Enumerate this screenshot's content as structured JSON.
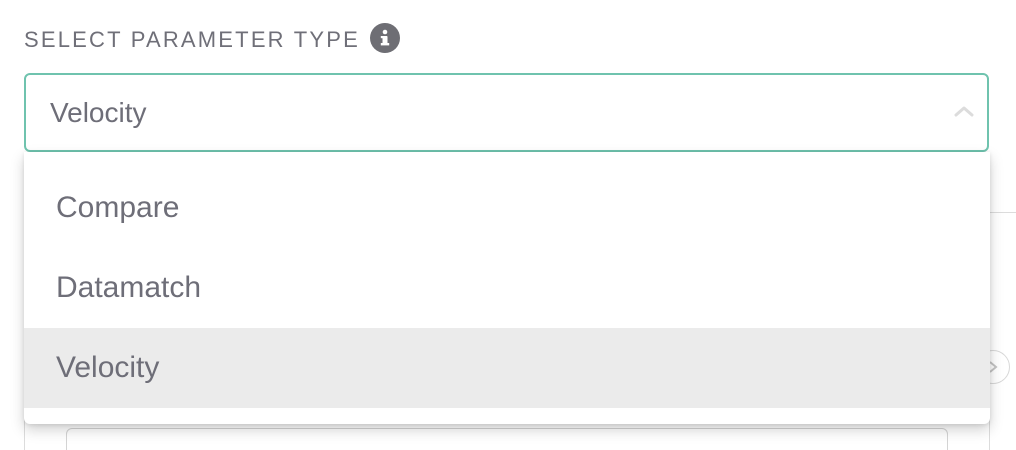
{
  "parameter_type": {
    "label": "SELECT PARAMETER TYPE",
    "info_icon": "info-icon",
    "selected_value": "Velocity",
    "accent_color": "#6fc3ae",
    "options": [
      {
        "label": "Compare",
        "selected": false
      },
      {
        "label": "Datamatch",
        "selected": false
      },
      {
        "label": "Velocity",
        "selected": true
      }
    ],
    "expanded": true
  }
}
